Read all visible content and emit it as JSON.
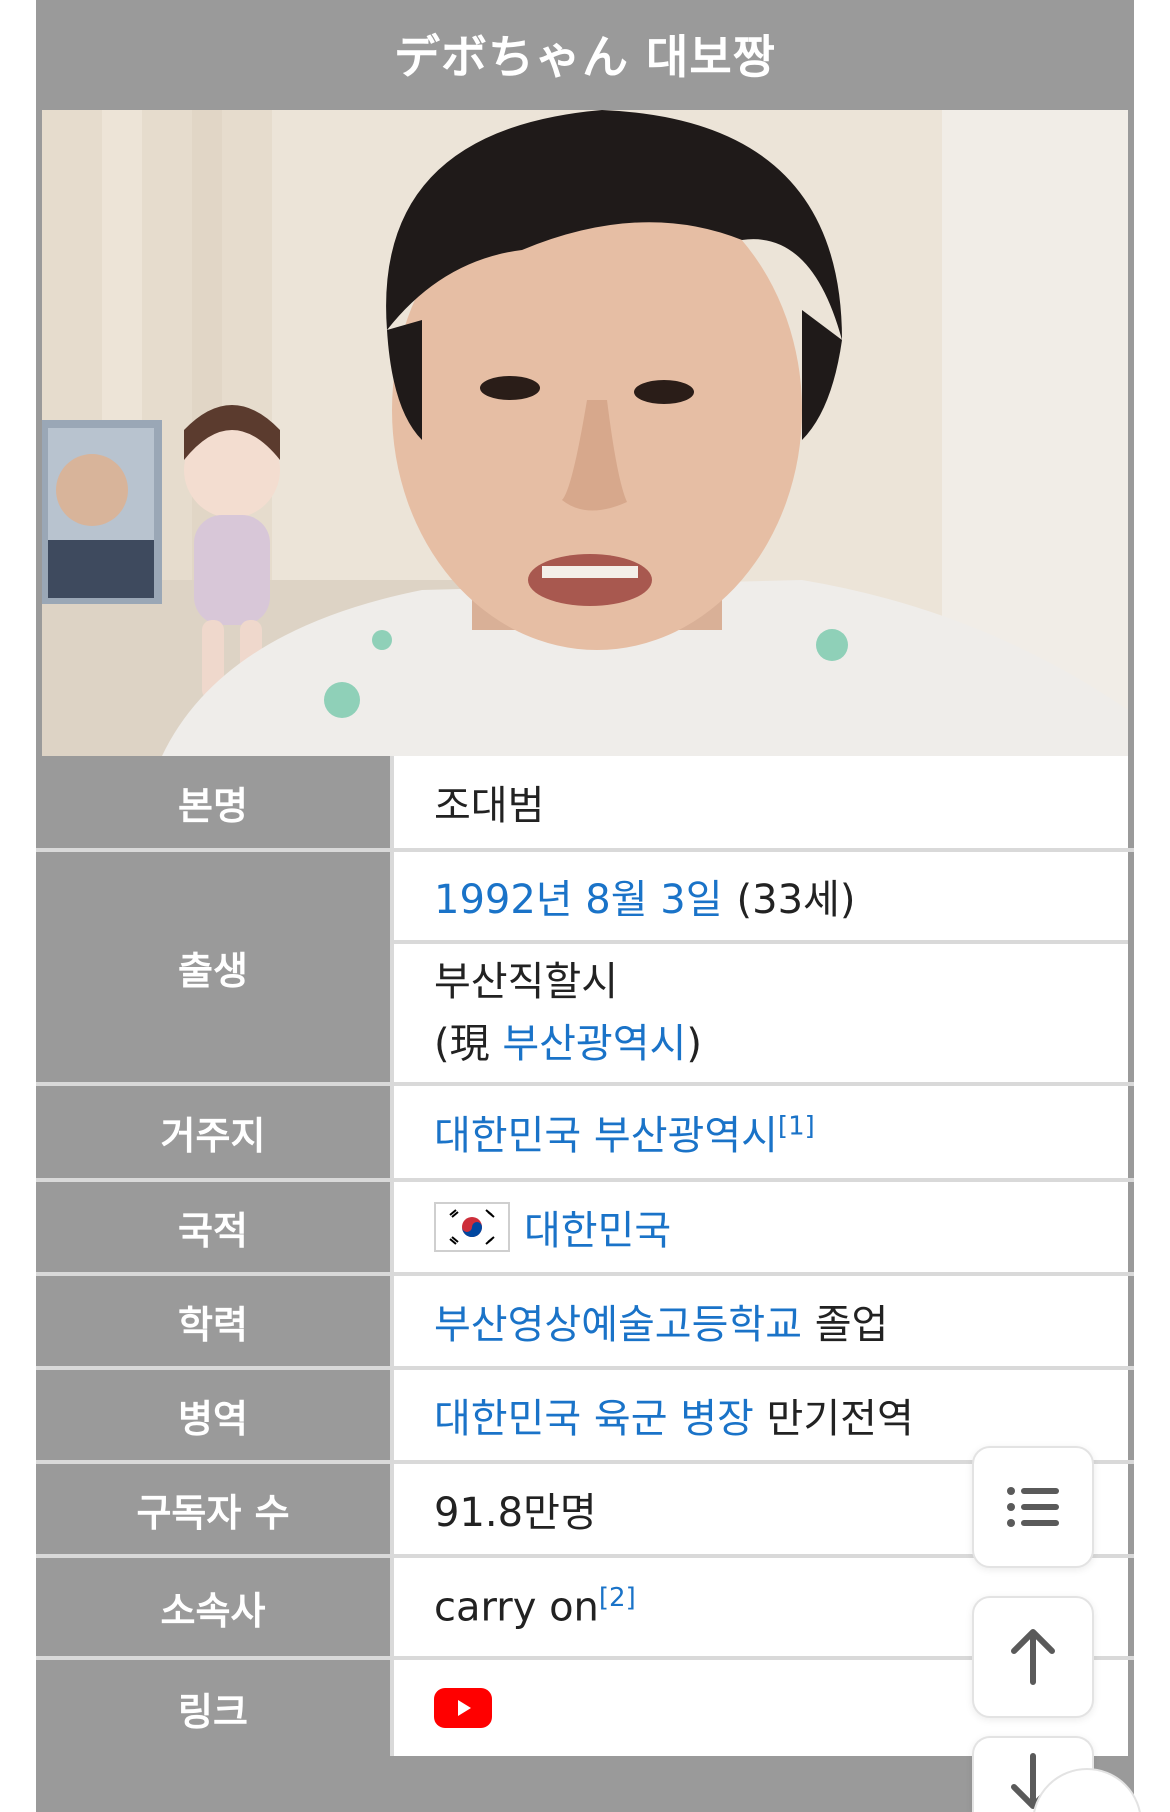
{
  "title": "デボちゃん 대보짱",
  "photo_alt": "",
  "rows": {
    "name": {
      "label": "본명",
      "value": "조대범"
    },
    "birth": {
      "label": "출생",
      "date_link": "1992년 8월 3일",
      "age": "(33세)",
      "place": "부산직할시",
      "now_prefix": "(現 ",
      "now_link": "부산광역시",
      "now_suffix": ")"
    },
    "residence": {
      "label": "거주지",
      "link": "대한민국 부산광역시",
      "ref": "[1]"
    },
    "nationality": {
      "label": "국적",
      "link": "대한민국"
    },
    "education": {
      "label": "학력",
      "link": "부산영상예술고등학교",
      "suffix": " 졸업"
    },
    "military": {
      "label": "병역",
      "link": "대한민국 육군 병장",
      "suffix": " 만기전역"
    },
    "subscribers": {
      "label": "구독자 수",
      "value": "91.8만명"
    },
    "agency": {
      "label": "소속사",
      "value": "carry on",
      "ref": "[2]"
    },
    "links": {
      "label": "링크"
    }
  },
  "colors": {
    "header_bg": "#9a9a9a",
    "link": "#1a73c8",
    "divider": "#d9d9d9",
    "youtube": "#ff0000"
  },
  "icons": [
    "toc-list-icon",
    "arrow-up-icon",
    "arrow-down-icon",
    "youtube-icon",
    "korea-flag-icon"
  ]
}
